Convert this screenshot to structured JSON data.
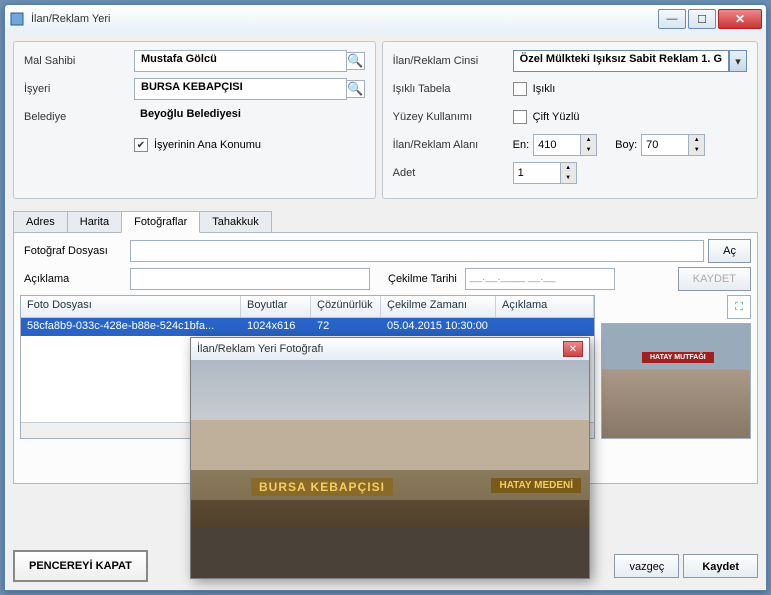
{
  "window": {
    "title": "İlan/Reklam Yeri"
  },
  "left": {
    "mal_sahibi_label": "Mal Sahibi",
    "mal_sahibi": "Mustafa Gölcü",
    "isyeri_label": "İşyeri",
    "isyeri": "BURSA KEBAPÇISI",
    "belediye_label": "Belediye",
    "belediye": "Beyoğlu Belediyesi",
    "ana_konum": "İşyerinin Ana Konumu",
    "ana_konum_checked": true
  },
  "right": {
    "cinsi_label": "İlan/Reklam Cinsi",
    "cinsi": "Özel Mülkteki Işıksız Sabit Reklam 1. G",
    "isikli_label": "Işıklı Tabela",
    "isikli_text": "Işıklı",
    "isikli_checked": false,
    "yuzey_label": "Yüzey Kullanımı",
    "yuzey_text": "Çift Yüzlü",
    "yuzey_checked": false,
    "alan_label": "İlan/Reklam Alanı",
    "en_label": "En:",
    "en": "410",
    "boy_label": "Boy:",
    "boy": "70",
    "adet_label": "Adet",
    "adet": "1"
  },
  "tabs": {
    "t0": "Adres",
    "t1": "Harita",
    "t2": "Fotoğraflar",
    "t3": "Tahakkuk"
  },
  "photo_panel": {
    "dosya_label": "Fotoğraf Dosyası",
    "ac_btn": "Aç",
    "aciklama_label": "Açıklama",
    "cekilme_label": "Çekilme Tarihi",
    "cekilme_placeholder": "__.__.____ __.__",
    "kaydet_btn": "KAYDET"
  },
  "grid": {
    "cols": {
      "c0": "Foto Dosyası",
      "c1": "Boyutlar",
      "c2": "Çözünürlük",
      "c3": "Çekilme Zamanı",
      "c4": "Açıklama"
    },
    "row": {
      "file": "58cfa8b9-033c-428e-b88e-524c1bfa...",
      "boyut": "1024x616",
      "coz": "72",
      "zaman": "05.04.2015 10:30:00",
      "aciklama": ""
    }
  },
  "bottom": {
    "close": "PENCEREYİ KAPAT",
    "vazgec": "vazgeç",
    "kaydet": "Kaydet"
  },
  "popup": {
    "title": "İlan/Reklam Yeri Fotoğrafı",
    "sign1": "BURSA KEBAPÇISI",
    "sign2": "HATAY MEDENİ",
    "sign3": "HATAY MUTFAĞI"
  }
}
